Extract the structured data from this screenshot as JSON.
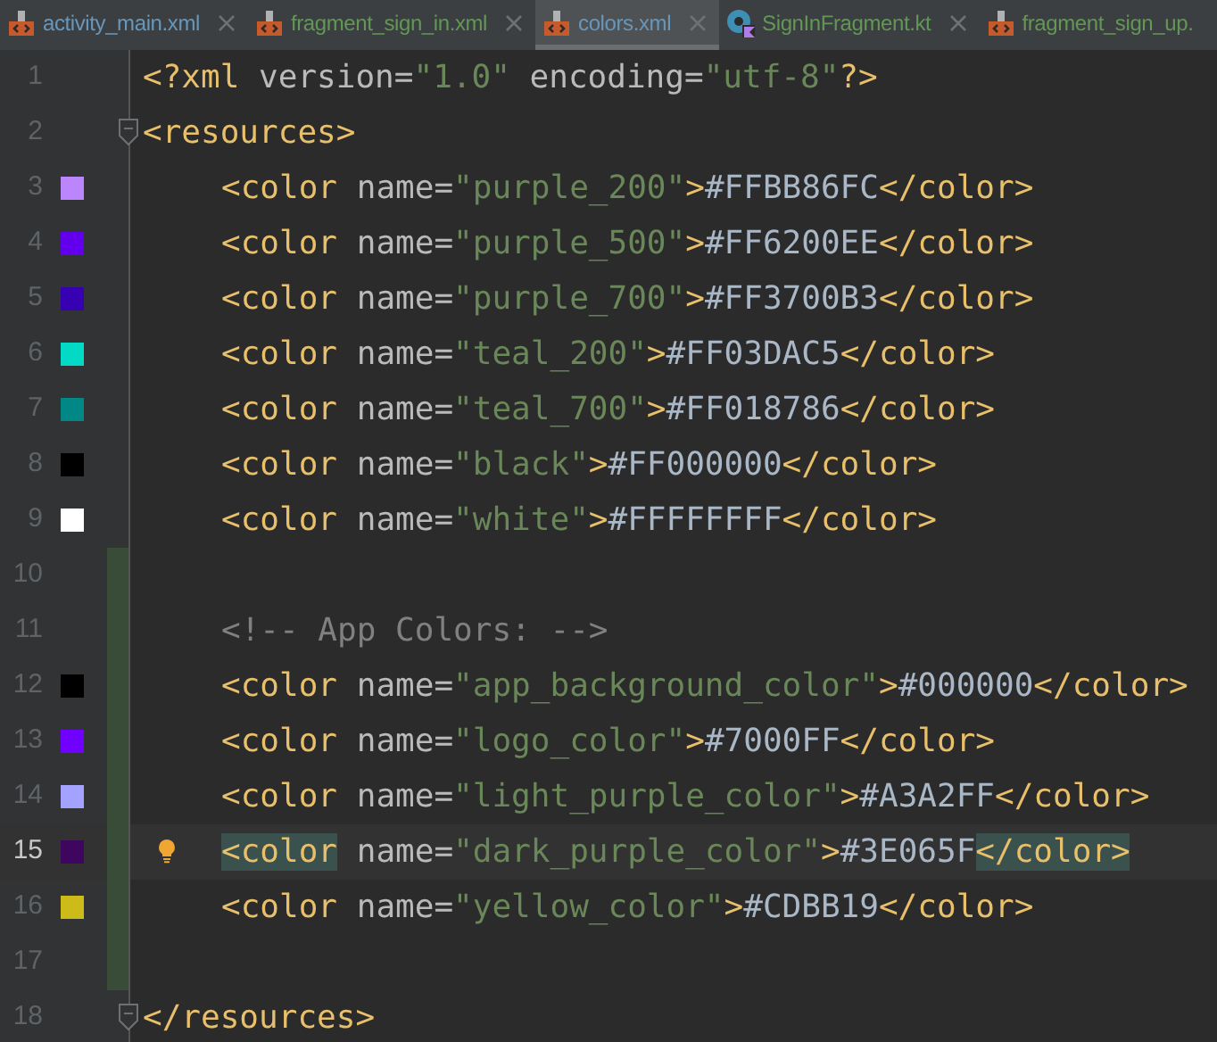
{
  "tabs": [
    {
      "label": "activity_main.xml",
      "kind": "xml",
      "color": "#6897bb",
      "selected": false,
      "closable": true
    },
    {
      "label": "fragment_sign_in.xml",
      "kind": "xml",
      "color": "#629755",
      "selected": false,
      "closable": true
    },
    {
      "label": "colors.xml",
      "kind": "xml",
      "color": "#6897bb",
      "selected": true,
      "closable": true
    },
    {
      "label": "SignInFragment.kt",
      "kind": "kotlin",
      "color": "#629755",
      "selected": false,
      "closable": true
    },
    {
      "label": "fragment_sign_up.",
      "kind": "xml",
      "color": "#629755",
      "selected": false,
      "closable": false
    }
  ],
  "lines": [
    {
      "number": "1",
      "segments": [
        {
          "kind": "tag",
          "text": "<?xml "
        },
        {
          "kind": "attr",
          "text": "version="
        },
        {
          "kind": "string",
          "text": "\"1.0\" "
        },
        {
          "kind": "attr",
          "text": "encoding="
        },
        {
          "kind": "string",
          "text": "\"utf-8\""
        },
        {
          "kind": "tag",
          "text": "?>"
        }
      ]
    },
    {
      "number": "2",
      "fold": true,
      "segments": [
        {
          "kind": "tag",
          "text": "<resources>"
        }
      ],
      "children": [
        {
          "number": "3",
          "color": "#bb86fc",
          "segments": [
            {
              "kind": "tag",
              "text": "<color "
            },
            {
              "kind": "attr",
              "text": "name="
            },
            {
              "kind": "string",
              "text": "\"purple_200\""
            },
            {
              "kind": "tag",
              "text": ">"
            },
            {
              "kind": "text",
              "text": "#FFBB86FC"
            },
            {
              "kind": "tag",
              "text": "</color>"
            }
          ]
        },
        {
          "number": "4",
          "color": "#6200ee",
          "segments": [
            {
              "kind": "tag",
              "text": "<color "
            },
            {
              "kind": "attr",
              "text": "name="
            },
            {
              "kind": "string",
              "text": "\"purple_500\""
            },
            {
              "kind": "tag",
              "text": ">"
            },
            {
              "kind": "text",
              "text": "#FF6200EE"
            },
            {
              "kind": "tag",
              "text": "</color>"
            }
          ]
        },
        {
          "number": "5",
          "color": "#3700b3",
          "segments": [
            {
              "kind": "tag",
              "text": "<color "
            },
            {
              "kind": "attr",
              "text": "name="
            },
            {
              "kind": "string",
              "text": "\"purple_700\""
            },
            {
              "kind": "tag",
              "text": ">"
            },
            {
              "kind": "text",
              "text": "#FF3700B3"
            },
            {
              "kind": "tag",
              "text": "</color>"
            }
          ]
        },
        {
          "number": "6",
          "color": "#03dac5",
          "segments": [
            {
              "kind": "tag",
              "text": "<color "
            },
            {
              "kind": "attr",
              "text": "name="
            },
            {
              "kind": "string",
              "text": "\"teal_200\""
            },
            {
              "kind": "tag",
              "text": ">"
            },
            {
              "kind": "text",
              "text": "#FF03DAC5"
            },
            {
              "kind": "tag",
              "text": "</color>"
            }
          ]
        },
        {
          "number": "7",
          "color": "#018786",
          "segments": [
            {
              "kind": "tag",
              "text": "<color "
            },
            {
              "kind": "attr",
              "text": "name="
            },
            {
              "kind": "string",
              "text": "\"teal_700\""
            },
            {
              "kind": "tag",
              "text": ">"
            },
            {
              "kind": "text",
              "text": "#FF018786"
            },
            {
              "kind": "tag",
              "text": "</color>"
            }
          ]
        },
        {
          "number": "8",
          "color": "#000000",
          "segments": [
            {
              "kind": "tag",
              "text": "<color "
            },
            {
              "kind": "attr",
              "text": "name="
            },
            {
              "kind": "string",
              "text": "\"black\""
            },
            {
              "kind": "tag",
              "text": ">"
            },
            {
              "kind": "text",
              "text": "#FF000000"
            },
            {
              "kind": "tag",
              "text": "</color>"
            }
          ]
        },
        {
          "number": "9",
          "color": "#ffffff",
          "segments": [
            {
              "kind": "tag",
              "text": "<color "
            },
            {
              "kind": "attr",
              "text": "name="
            },
            {
              "kind": "string",
              "text": "\"white\""
            },
            {
              "kind": "tag",
              "text": ">"
            },
            {
              "kind": "text",
              "text": "#FFFFFFFF"
            },
            {
              "kind": "tag",
              "text": "</color>"
            }
          ]
        },
        {
          "number": "10",
          "changed": true
        },
        {
          "number": "11",
          "changed": true,
          "segments": [
            {
              "kind": "comment",
              "text": "<!-- App Colors: -->"
            }
          ]
        },
        {
          "number": "12",
          "changed": true,
          "color": "#000000",
          "segments": [
            {
              "kind": "tag",
              "text": "<color "
            },
            {
              "kind": "attr",
              "text": "name="
            },
            {
              "kind": "string",
              "text": "\"app_background_color\""
            },
            {
              "kind": "tag",
              "text": ">"
            },
            {
              "kind": "text",
              "text": "#000000"
            },
            {
              "kind": "tag",
              "text": "</color>"
            }
          ]
        },
        {
          "number": "13",
          "changed": true,
          "color": "#7000ff",
          "segments": [
            {
              "kind": "tag",
              "text": "<color "
            },
            {
              "kind": "attr",
              "text": "name="
            },
            {
              "kind": "string",
              "text": "\"logo_color\""
            },
            {
              "kind": "tag",
              "text": ">"
            },
            {
              "kind": "text",
              "text": "#7000FF"
            },
            {
              "kind": "tag",
              "text": "</color>"
            }
          ]
        },
        {
          "number": "14",
          "changed": true,
          "color": "#a3a2ff",
          "segments": [
            {
              "kind": "tag",
              "text": "<color "
            },
            {
              "kind": "attr",
              "text": "name="
            },
            {
              "kind": "string",
              "text": "\"light_purple_color\""
            },
            {
              "kind": "tag",
              "text": ">"
            },
            {
              "kind": "text",
              "text": "#A3A2FF"
            },
            {
              "kind": "tag",
              "text": "</color>"
            }
          ]
        },
        {
          "number": "15",
          "changed": true,
          "current": true,
          "hint": true,
          "color": "#3e065f",
          "segments": [
            {
              "kind": "tag",
              "text": "<color",
              "matched": true
            },
            {
              "kind": "attr",
              "text": " name="
            },
            {
              "kind": "string",
              "text": "\"dark_purple_color\""
            },
            {
              "kind": "tag",
              "text": ">"
            },
            {
              "kind": "text",
              "text": "#3E065F"
            },
            {
              "kind": "tag",
              "text": "</color>",
              "matched": true
            }
          ]
        },
        {
          "number": "16",
          "changed": true,
          "color": "#cdbb19",
          "segments": [
            {
              "kind": "tag",
              "text": "<color "
            },
            {
              "kind": "attr",
              "text": "name="
            },
            {
              "kind": "string",
              "text": "\"yellow_color\""
            },
            {
              "kind": "tag",
              "text": ">"
            },
            {
              "kind": "text",
              "text": "#CDBB19"
            },
            {
              "kind": "tag",
              "text": "</color>"
            }
          ]
        },
        {
          "number": "17",
          "changed": true
        }
      ]
    },
    {
      "number": "18",
      "fold": true,
      "segments": [
        {
          "kind": "tag",
          "text": "</resources>"
        }
      ]
    }
  ]
}
